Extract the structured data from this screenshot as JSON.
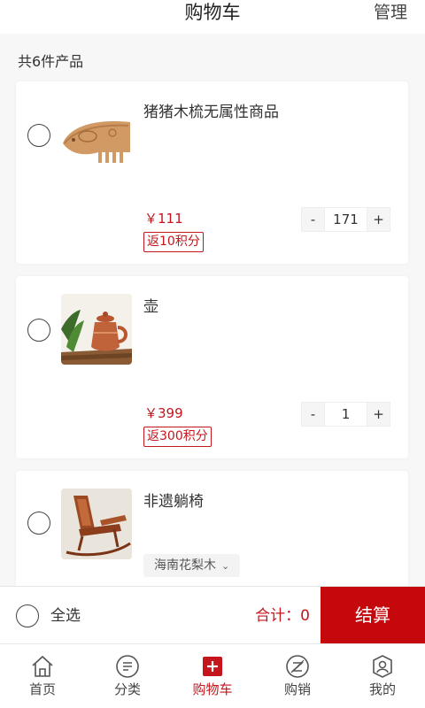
{
  "header": {
    "title": "购物车",
    "manage": "管理"
  },
  "summary": {
    "count_text": "共6件产品"
  },
  "items": [
    {
      "name": "猪猪木梳无属性商品",
      "price": "￥111",
      "points": "返10积分",
      "qty": "171",
      "minus": "-",
      "plus": "+"
    },
    {
      "name": "壶",
      "price": "￥399",
      "points": "返300积分",
      "qty": "1",
      "minus": "-",
      "plus": "+"
    },
    {
      "name": "非遗躺椅",
      "variant": "海南花梨木"
    }
  ],
  "checkout": {
    "select_all": "全选",
    "total": "合计：0",
    "pay": "结算"
  },
  "tabs": [
    {
      "label": "首页",
      "icon": "home-icon"
    },
    {
      "label": "分类",
      "icon": "category-icon"
    },
    {
      "label": "购物车",
      "icon": "cart-icon",
      "active": true
    },
    {
      "label": "购销",
      "icon": "trade-icon"
    },
    {
      "label": "我的",
      "icon": "profile-icon"
    }
  ],
  "colors": {
    "accent": "#c4161c",
    "pay_button": "#c4080c"
  }
}
